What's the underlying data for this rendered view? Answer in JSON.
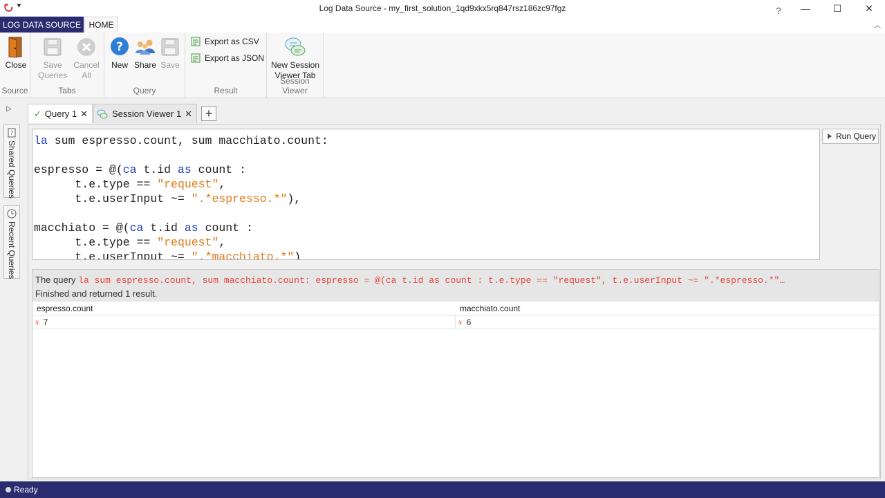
{
  "window": {
    "title": "Log Data Source - my_first_solution_1qd9xkx5rq847rsz186zc97fgz",
    "help": "?",
    "minimize": "—",
    "maximize": "☐",
    "close": "✕"
  },
  "ribbon_tabs": {
    "source": "LOG DATA SOURCE",
    "home": "HOME"
  },
  "ribbon": {
    "source_group": {
      "label": "Source",
      "close": "Close"
    },
    "tabs_group": {
      "label": "Tabs",
      "save_queries_1": "Save",
      "save_queries_2": "Queries",
      "cancel_all_1": "Cancel",
      "cancel_all_2": "All"
    },
    "query_group": {
      "label": "Query",
      "new": "New",
      "share": "Share",
      "save": "Save"
    },
    "result_group": {
      "label": "Result",
      "export_csv": "Export as CSV",
      "export_json": "Export as JSON"
    },
    "session_group": {
      "label": "Session Viewer",
      "new_session_1": "New Session",
      "new_session_2": "Viewer Tab"
    }
  },
  "side_tabs": {
    "shared": "Shared Queries",
    "recent": "Recent Queries"
  },
  "doc_tabs": [
    {
      "label": "Query 1"
    },
    {
      "label": "Session Viewer 1"
    }
  ],
  "editor": {
    "line1_kw": "la",
    "line1_rest": " sum espresso.count, sum macchiato.count:",
    "line3_a": "espresso = @(",
    "line3_kw1": "ca",
    "line3_b": " t.id ",
    "line3_kw2": "as",
    "line3_c": " count :",
    "line4_a": "      t.e.type == ",
    "line4_str": "\"request\"",
    "line4_b": ",",
    "line5_a": "      t.e.userInput ~= ",
    "line5_str": "\".*espresso.*\"",
    "line5_b": "),",
    "line7_a": "macchiato = @(",
    "line7_kw1": "ca",
    "line7_b": " t.id ",
    "line7_kw2": "as",
    "line7_c": " count :",
    "line8_a": "      t.e.type == ",
    "line8_str": "\"request\"",
    "line8_b": ",",
    "line9_a": "      t.e.userInput ~= ",
    "line9_str": "\".*macchiato.*\"",
    "line9_b": ")"
  },
  "run_query": "Run Query",
  "result": {
    "query_prefix": "The query ",
    "query_text": "la sum espresso.count, sum macchiato.count:  espresso = @(ca t.id as count :       t.e.type == \"request\",       t.e.userInput ~= \".*espresso.*\"…",
    "status": "Finished and returned 1 result.",
    "columns": [
      "espresso.count",
      "macchiato.count"
    ],
    "rows": [
      [
        "7",
        "6"
      ]
    ],
    "fx_symbol": "𝑥"
  },
  "statusbar": {
    "text": "Ready"
  },
  "colors": {
    "brand": "#2b2c6f",
    "keyword": "#1f3fbf",
    "string": "#e07b1a",
    "query_red": "#e8453c"
  }
}
